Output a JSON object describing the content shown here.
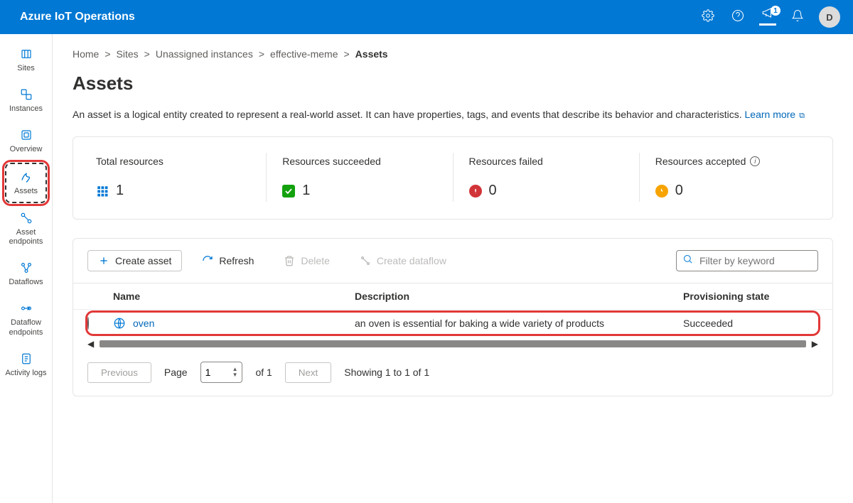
{
  "header": {
    "title": "Azure IoT Operations",
    "whatsnew_badge": "1",
    "avatar_initial": "D"
  },
  "sidebar": {
    "items": [
      {
        "label": "Sites"
      },
      {
        "label": "Instances"
      },
      {
        "label": "Overview"
      },
      {
        "label": "Assets"
      },
      {
        "label": "Asset endpoints"
      },
      {
        "label": "Dataflows"
      },
      {
        "label": "Dataflow endpoints"
      },
      {
        "label": "Activity logs"
      }
    ]
  },
  "breadcrumb": {
    "home": "Home",
    "sites": "Sites",
    "unassigned": "Unassigned instances",
    "instance": "effective-meme",
    "current": "Assets"
  },
  "page": {
    "title": "Assets",
    "description": "An asset is a logical entity created to represent a real-world asset. It can have properties, tags, and events that describe its behavior and characteristics. ",
    "learn_more": "Learn more"
  },
  "stats": {
    "total": {
      "label": "Total resources",
      "value": "1"
    },
    "succeeded": {
      "label": "Resources succeeded",
      "value": "1"
    },
    "failed": {
      "label": "Resources failed",
      "value": "0"
    },
    "accepted": {
      "label": "Resources accepted",
      "value": "0"
    }
  },
  "toolbar": {
    "create": "Create asset",
    "refresh": "Refresh",
    "delete": "Delete",
    "create_dataflow": "Create dataflow",
    "filter_placeholder": "Filter by keyword"
  },
  "table": {
    "headers": {
      "name": "Name",
      "description": "Description",
      "state": "Provisioning state"
    },
    "rows": [
      {
        "name": "oven",
        "description": "an oven is essential for baking a wide variety of products",
        "state": "Succeeded"
      }
    ]
  },
  "pagination": {
    "previous": "Previous",
    "next": "Next",
    "page_label": "Page",
    "page_value": "1",
    "of_label": "of 1",
    "showing": "Showing 1 to 1 of 1"
  }
}
